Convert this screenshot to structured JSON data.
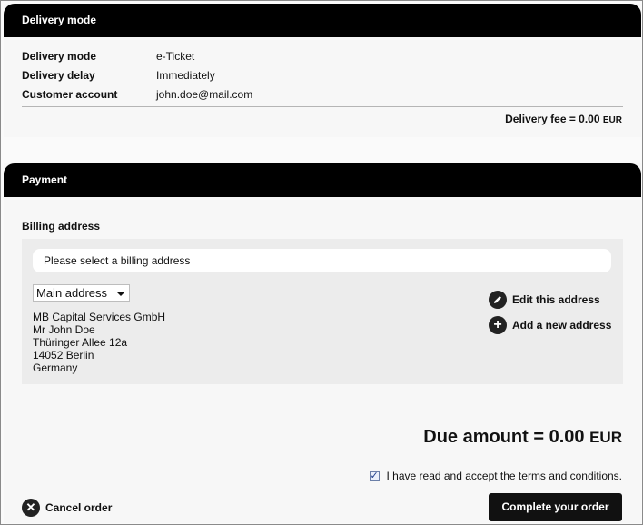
{
  "delivery": {
    "header": "Delivery mode",
    "rows": [
      {
        "label": "Delivery mode",
        "value": "e-Ticket"
      },
      {
        "label": "Delivery delay",
        "value": "Immediately"
      },
      {
        "label": "Customer account",
        "value": "john.doe@mail.com"
      }
    ],
    "fee_label": "Delivery fee = 0.00",
    "fee_currency": "EUR"
  },
  "payment": {
    "header": "Payment",
    "billing_title": "Billing address",
    "notice": "Please select a billing address",
    "select_value": "Main address",
    "address_lines": [
      "MB Capital Services GmbH",
      "Mr John Doe",
      "Thüringer Allee 12a",
      "14052 Berlin",
      "Germany"
    ],
    "edit_label": "Edit this address",
    "add_label": "Add a new address",
    "due_label": "Due amount = 0.00",
    "due_currency": "EUR",
    "terms_label": "I have read and accept the terms and conditions.",
    "cancel_label": "Cancel order",
    "complete_label": "Complete your order"
  }
}
